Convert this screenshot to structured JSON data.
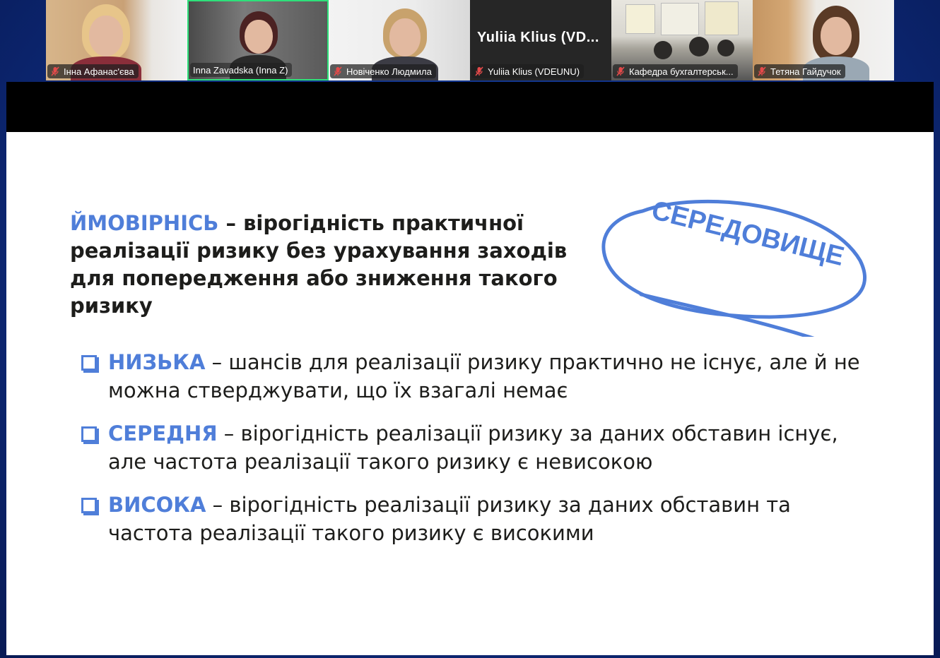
{
  "participants": [
    {
      "name": "Інна Афанас'єва",
      "muted": true,
      "active": false
    },
    {
      "name": "Inna Zavadska (Inna Z)",
      "muted": false,
      "active": true
    },
    {
      "name": "Новіченко Людмила",
      "muted": true,
      "active": false
    },
    {
      "name": "Yuliia Klius (VDEUNU)",
      "muted": true,
      "active": false,
      "title": "Yuliia  Klius  (VD..."
    },
    {
      "name": "Кафедра бухгалтерськ...",
      "muted": true,
      "active": false
    },
    {
      "name": "Тетяна Гайдучок",
      "muted": true,
      "active": false
    }
  ],
  "slide": {
    "heading_term": "ЙМОВІРНІСЬ",
    "heading_rest": " – вірогідність практичної реалізації ризику без урахування заходів для попередження або зниження такого ризику",
    "stamp_text": "СЕРЕДОВИЩЕ",
    "items": [
      {
        "term": "НИЗЬКА",
        "text": " – шансів для реалізації ризику практично не існує, але й не можна стверджувати, що їх взагалі немає"
      },
      {
        "term": "СЕРЕДНЯ",
        "text": " – вірогідність реалізації ризику за даних обставин існує, але частота реалізації такого ризику є невисокою"
      },
      {
        "term": "ВИСОКА",
        "text": " – вірогідність реалізації ризику за даних обставин та частота реалізації такого ризику є високими"
      }
    ]
  },
  "colors": {
    "accent": "#4f7ed9",
    "active_speaker": "#2ee07a",
    "text": "#1d1d1b"
  }
}
